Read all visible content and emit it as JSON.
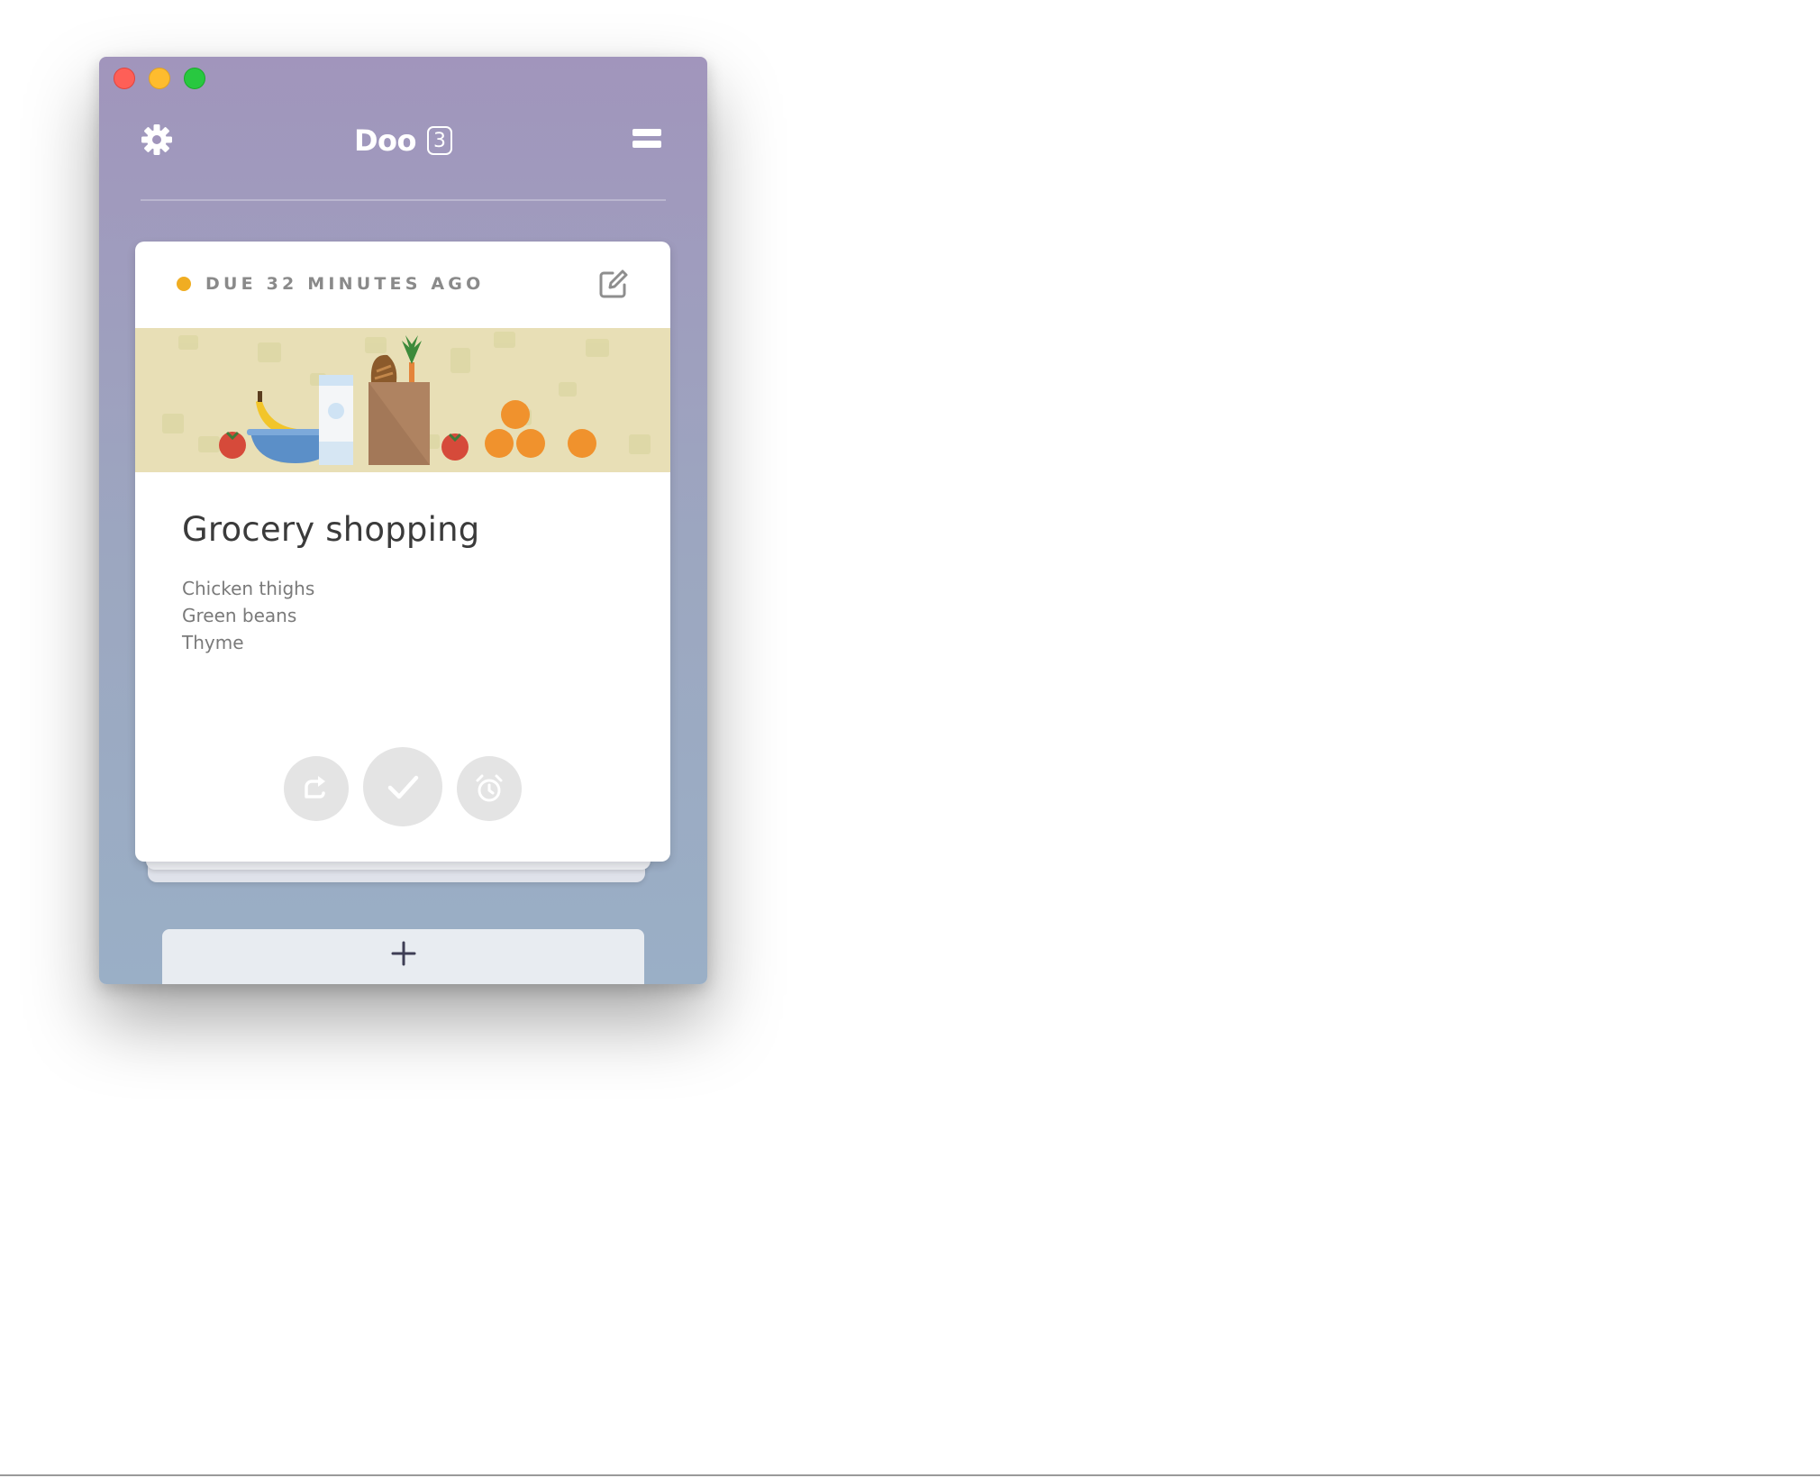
{
  "window": {
    "controls": [
      "close",
      "minimize",
      "zoom"
    ]
  },
  "header": {
    "app_name": "Doo",
    "task_count": "3",
    "settings_icon": "gear-icon",
    "menu_icon": "menu-icon"
  },
  "card": {
    "due_text": "DUE 32 MINUTES AGO",
    "due_color": "#f0ad22",
    "edit_icon": "edit-icon",
    "banner_illustration": "groceries-illustration",
    "title": "Grocery shopping",
    "notes": [
      "Chicken thighs",
      "Green beans",
      "Thyme"
    ],
    "actions": [
      {
        "icon": "defer-icon"
      },
      {
        "icon": "checkmark-icon"
      },
      {
        "icon": "alarm-clock-icon"
      }
    ]
  },
  "add_button": {
    "icon": "plus-icon",
    "label": "+"
  },
  "colors": {
    "window_gradient_top": "#a195bc",
    "window_gradient_bottom": "#9aafc6",
    "card_background": "#ffffff",
    "action_button": "#e4e4e4",
    "add_bar": "#e8ecf1"
  }
}
